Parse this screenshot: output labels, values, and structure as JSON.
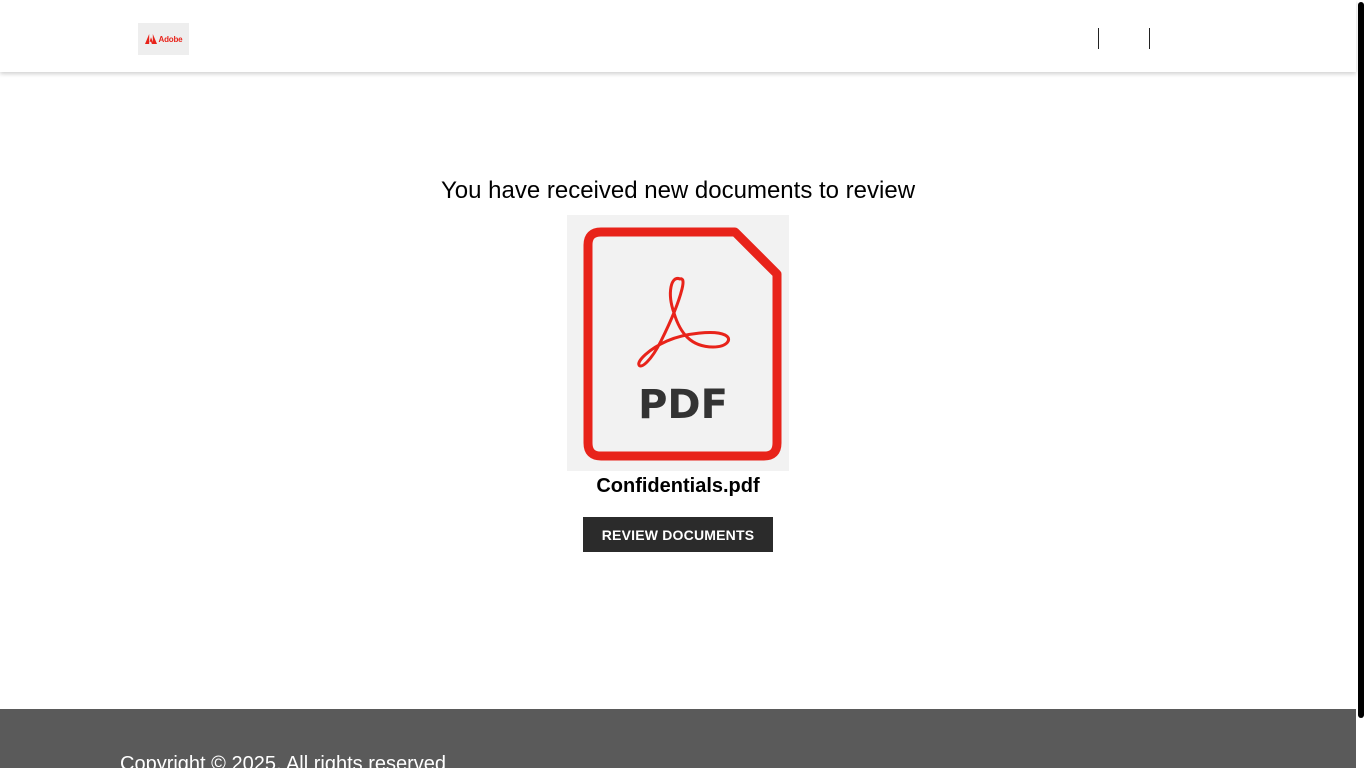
{
  "header": {
    "logo_text": "Adobe"
  },
  "main": {
    "headline": "You have received new documents to review",
    "document": {
      "icon_label": "PDF",
      "name": "Confidentials.pdf"
    },
    "review_button_label": "REVIEW DOCUMENTS"
  },
  "footer": {
    "copyright": "Copyright © 2025. All rights reserved"
  },
  "colors": {
    "brand_red": "#e8231a",
    "button_bg": "#2b2b2b",
    "footer_bg": "#5a5a5a"
  },
  "icons": {
    "logo": "adobe-logo-icon",
    "document": "pdf-file-icon"
  }
}
